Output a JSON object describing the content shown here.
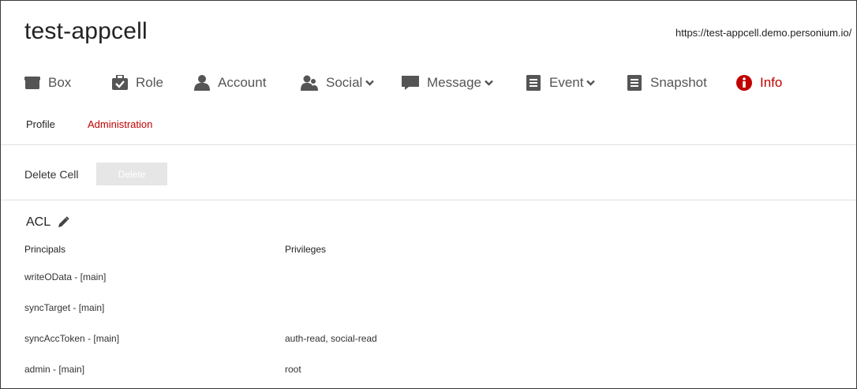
{
  "header": {
    "cell_name": "test-appcell",
    "cell_url": "https://test-appcell.demo.personium.io/"
  },
  "nav": {
    "items": [
      {
        "label": "Box",
        "icon": "box-icon",
        "dropdown": false,
        "active": false
      },
      {
        "label": "Role",
        "icon": "role-badge-icon",
        "dropdown": false,
        "active": false
      },
      {
        "label": "Account",
        "icon": "user-icon",
        "dropdown": false,
        "active": false
      },
      {
        "label": "Social",
        "icon": "social-icon",
        "dropdown": true,
        "active": false
      },
      {
        "label": "Message",
        "icon": "message-icon",
        "dropdown": true,
        "active": false
      },
      {
        "label": "Event",
        "icon": "event-icon",
        "dropdown": true,
        "active": false
      },
      {
        "label": "Snapshot",
        "icon": "snapshot-icon",
        "dropdown": false,
        "active": false
      },
      {
        "label": "Info",
        "icon": "info-icon",
        "dropdown": false,
        "active": true
      }
    ]
  },
  "subtabs": {
    "profile": "Profile",
    "administration": "Administration",
    "active": "administration"
  },
  "delete_cell": {
    "label": "Delete Cell",
    "button": "Delete"
  },
  "acl": {
    "title": "ACL",
    "columns": {
      "principals": "Principals",
      "privileges": "Privileges"
    },
    "rows": [
      {
        "principal": "writeOData - [main]",
        "privileges": ""
      },
      {
        "principal": "syncTarget - [main]",
        "privileges": ""
      },
      {
        "principal": "syncAccToken - [main]",
        "privileges": "auth-read, social-read"
      },
      {
        "principal": "admin - [main]",
        "privileges": "root"
      }
    ]
  },
  "colors": {
    "accent_red": "#c00000",
    "text_dark": "#222222",
    "icon_gray": "#555555",
    "disabled_button": "#e6e6e6",
    "divider": "#e0e0e0"
  }
}
